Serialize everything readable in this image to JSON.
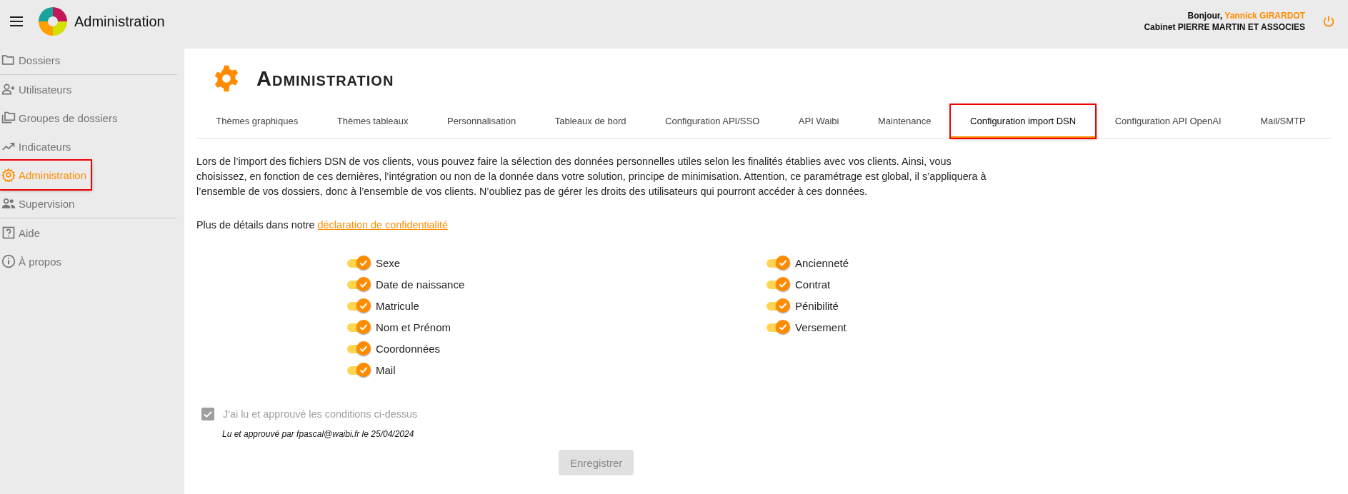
{
  "header": {
    "app_title": "Administration",
    "greeting": "Bonjour,",
    "user_name": "Yannick GIRARDOT",
    "company": "Cabinet PIERRE MARTIN ET ASSOCIES"
  },
  "sidebar": {
    "groups": [
      [
        {
          "label": "Dossiers",
          "selected": false,
          "highlighted": false
        }
      ],
      [
        {
          "label": "Utilisateurs",
          "selected": false,
          "highlighted": false
        },
        {
          "label": "Groupes de dossiers",
          "selected": false,
          "highlighted": false
        },
        {
          "label": "Indicateurs",
          "selected": false,
          "highlighted": false
        },
        {
          "label": "Administration",
          "selected": true,
          "highlighted": true
        },
        {
          "label": "Supervision",
          "selected": false,
          "highlighted": false
        }
      ],
      [
        {
          "label": "Aide",
          "selected": false,
          "highlighted": false
        },
        {
          "label": "À propos",
          "selected": false,
          "highlighted": false
        }
      ]
    ]
  },
  "page": {
    "title": "Administration",
    "tabs": [
      {
        "label": "Thèmes graphiques",
        "selected": false,
        "highlighted": false
      },
      {
        "label": "Thèmes tableaux",
        "selected": false,
        "highlighted": false
      },
      {
        "label": "Personnalisation",
        "selected": false,
        "highlighted": false
      },
      {
        "label": "Tableaux de bord",
        "selected": false,
        "highlighted": false
      },
      {
        "label": "Configuration API/SSO",
        "selected": false,
        "highlighted": false
      },
      {
        "label": "API Waibi",
        "selected": false,
        "highlighted": false
      },
      {
        "label": "Maintenance",
        "selected": false,
        "highlighted": false
      },
      {
        "label": "Configuration import DSN",
        "selected": true,
        "highlighted": true
      },
      {
        "label": "Configuration API OpenAI",
        "selected": false,
        "highlighted": false
      },
      {
        "label": "Mail/SMTP",
        "selected": false,
        "highlighted": false
      }
    ],
    "intro": "Lors de l’import des fichiers DSN de vos clients, vous pouvez faire la sélection des données personnelles utiles selon les finalités établies avec vos clients. Ainsi, vous choisissez, en fonction de ces dernières, l’intégration ou non de la donnée dans votre solution, principe de minimisation. Attention, ce paramétrage est global, il s’appliquera à l’ensemble de vos dossiers, donc à l’ensemble de vos clients. N’oubliez pas de gérer les droits des utilisateurs qui pourront accéder à ces données.",
    "details_text": "Plus de détails dans notre",
    "details_link": "déclaration de confidentialité",
    "toggle_columns": [
      [
        {
          "label": "Sexe",
          "on": true
        },
        {
          "label": "Date de naissance",
          "on": true
        },
        {
          "label": "Matricule",
          "on": true
        },
        {
          "label": "Nom et Prénom",
          "on": true
        },
        {
          "label": "Coordonnées",
          "on": true
        },
        {
          "label": "Mail",
          "on": true
        }
      ],
      [
        {
          "label": "Ancienneté",
          "on": true
        },
        {
          "label": "Contrat",
          "on": true
        },
        {
          "label": "Pénibilité",
          "on": true
        },
        {
          "label": "Versement",
          "on": true
        }
      ]
    ],
    "consent": {
      "label": "J'ai lu et approuvé les conditions ci-dessus",
      "checked": true,
      "disabled": true
    },
    "approval_note": "Lu et approuvé par fpascal@waibi.fr le 25/04/2024",
    "save_button": {
      "label": "Enregistrer",
      "disabled": true
    }
  }
}
